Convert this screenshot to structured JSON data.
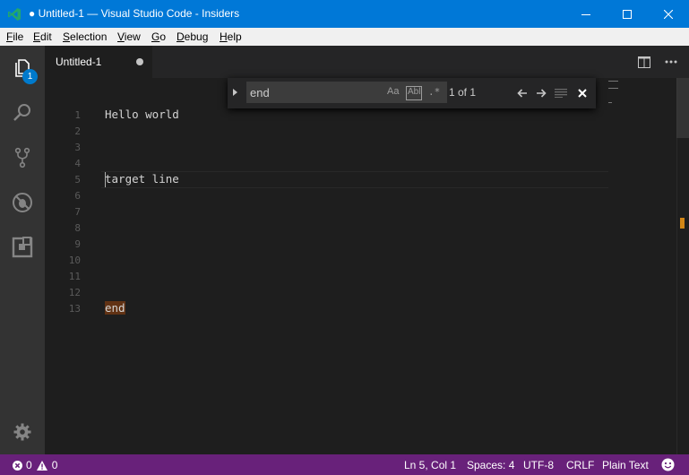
{
  "window": {
    "title": "● Untitled-1 — Visual Studio Code - Insiders"
  },
  "menu": {
    "items": [
      {
        "first": "F",
        "rest": "ile"
      },
      {
        "first": "E",
        "rest": "dit"
      },
      {
        "first": "S",
        "rest": "election"
      },
      {
        "first": "V",
        "rest": "iew"
      },
      {
        "first": "G",
        "rest": "o"
      },
      {
        "first": "D",
        "rest": "ebug"
      },
      {
        "first": "H",
        "rest": "elp"
      }
    ]
  },
  "activity": {
    "explorer_badge": "1",
    "icons": [
      "files-icon",
      "search-icon",
      "source-control-icon",
      "debug-icon",
      "extensions-icon",
      "gear-icon"
    ]
  },
  "tab": {
    "label": "Untitled-1"
  },
  "editor": {
    "line_numbers": [
      "1",
      "2",
      "3",
      "4",
      "5",
      "6",
      "7",
      "8",
      "9",
      "10",
      "11",
      "12",
      "13"
    ],
    "lines": [
      {
        "n": "1",
        "text": "Hello world"
      },
      {
        "n": "5",
        "text": "target line"
      },
      {
        "n": "13",
        "text": "end"
      }
    ]
  },
  "find": {
    "query": "end",
    "match_case": "Aa",
    "whole_word": "Abl",
    "regex": ".*",
    "count": "1 of 1"
  },
  "status": {
    "errors": "0",
    "warnings": "0",
    "position": "Ln 5, Col 1",
    "indent": "Spaces: 4",
    "encoding": "UTF-8",
    "eol": "CRLF",
    "language": "Plain Text"
  },
  "colors": {
    "titlebar": "#0078d7",
    "statusbar": "#68217a",
    "editor_bg": "#1e1e1e",
    "match_highlight": "#613214"
  }
}
